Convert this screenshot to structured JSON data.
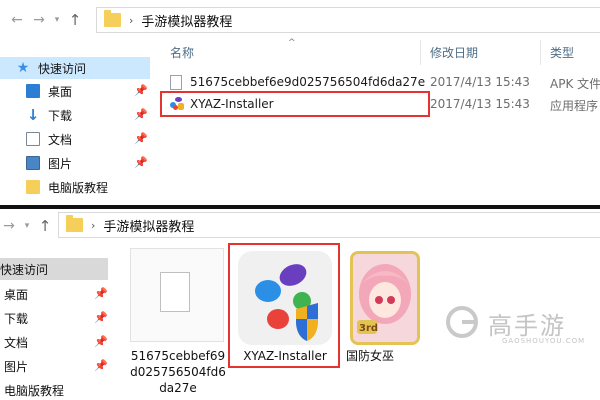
{
  "window_top": {
    "breadcrumb": "手游模拟器教程",
    "sidebar": {
      "quick_access": "快速访问",
      "items": [
        {
          "label": "桌面",
          "icon": "desktop-icon",
          "pinned": true
        },
        {
          "label": "下载",
          "icon": "download-icon",
          "pinned": true
        },
        {
          "label": "文档",
          "icon": "document-icon",
          "pinned": true
        },
        {
          "label": "图片",
          "icon": "picture-icon",
          "pinned": true
        },
        {
          "label": "电脑版教程",
          "icon": "folder-icon",
          "pinned": false
        }
      ]
    },
    "columns": {
      "name": "名称",
      "date": "修改日期",
      "type": "类型"
    },
    "files": [
      {
        "name": "51675cebbef6e9d025756504fd6da27e",
        "date": "2017/4/13 15:43",
        "type": "APK 文件"
      },
      {
        "name": "XYAZ-Installer",
        "date": "2017/4/13 15:43",
        "type": "应用程序"
      }
    ]
  },
  "window_bottom": {
    "breadcrumb": "手游模拟器教程",
    "sidebar": {
      "quick_access": "快速访问",
      "items": [
        {
          "label": "桌面",
          "pinned": true
        },
        {
          "label": "下载",
          "pinned": true
        },
        {
          "label": "文档",
          "pinned": true
        },
        {
          "label": "图片",
          "pinned": true
        },
        {
          "label": "电脑版教程",
          "pinned": false
        }
      ]
    },
    "tiles": [
      {
        "caption": "51675cebbef69d025756504fd6da27e"
      },
      {
        "caption": "XYAZ-Installer"
      },
      {
        "caption": "国防女巫"
      }
    ]
  },
  "watermark": {
    "brand": "高手游",
    "url": "GAOSHOUYOU.COM"
  },
  "colors": {
    "highlight": "#e3342f",
    "folder": "#f6cf5a",
    "selected": "#cce8ff",
    "accent": "#2a7fd4"
  }
}
